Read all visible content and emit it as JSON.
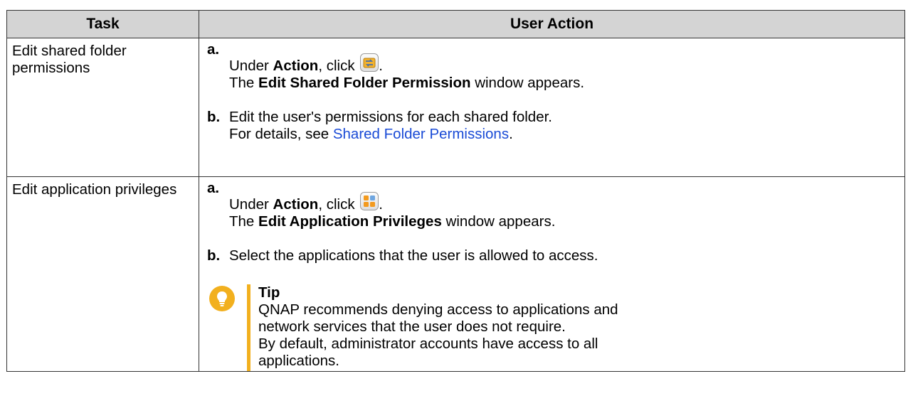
{
  "header": {
    "task": "Task",
    "user_action": "User Action"
  },
  "rows": [
    {
      "task": "Edit shared folder permissions",
      "step_a": {
        "letter": "a.",
        "prefix": "Under ",
        "bold": "Action",
        "middle": ", click ",
        "after_icon": ".",
        "line2_prefix": "The ",
        "line2_bold": "Edit Shared Folder Permission",
        "line2_suffix": " window appears.",
        "icon": "folder-permission-icon"
      },
      "step_b": {
        "letter": "b.",
        "text": "Edit the user's permissions for each shared folder.",
        "line2_prefix": "For details, see ",
        "link": "Shared Folder Permissions",
        "line2_suffix": "."
      }
    },
    {
      "task": "Edit application privileges",
      "step_a": {
        "letter": "a.",
        "prefix": "Under ",
        "bold": "Action",
        "middle": ", click ",
        "after_icon": ".",
        "line2_prefix": "The ",
        "line2_bold": "Edit Application Privileges",
        "line2_suffix": " window appears.",
        "icon": "application-privileges-icon"
      },
      "step_b": {
        "letter": "b.",
        "text": "Select the applications that the user is allowed to access."
      },
      "tip": {
        "icon": "lightbulb-icon",
        "title": "Tip",
        "line1": "QNAP recommends denying access to applications and",
        "line2": "network services that the user does not require.",
        "line3": "By default, administrator accounts have access to all",
        "line4": "applications.",
        "accent_color": "#f2b01e"
      }
    }
  ],
  "colors": {
    "header_bg": "#d4d4d4",
    "link": "#1a4bd6",
    "tip_accent": "#f2b01e"
  }
}
